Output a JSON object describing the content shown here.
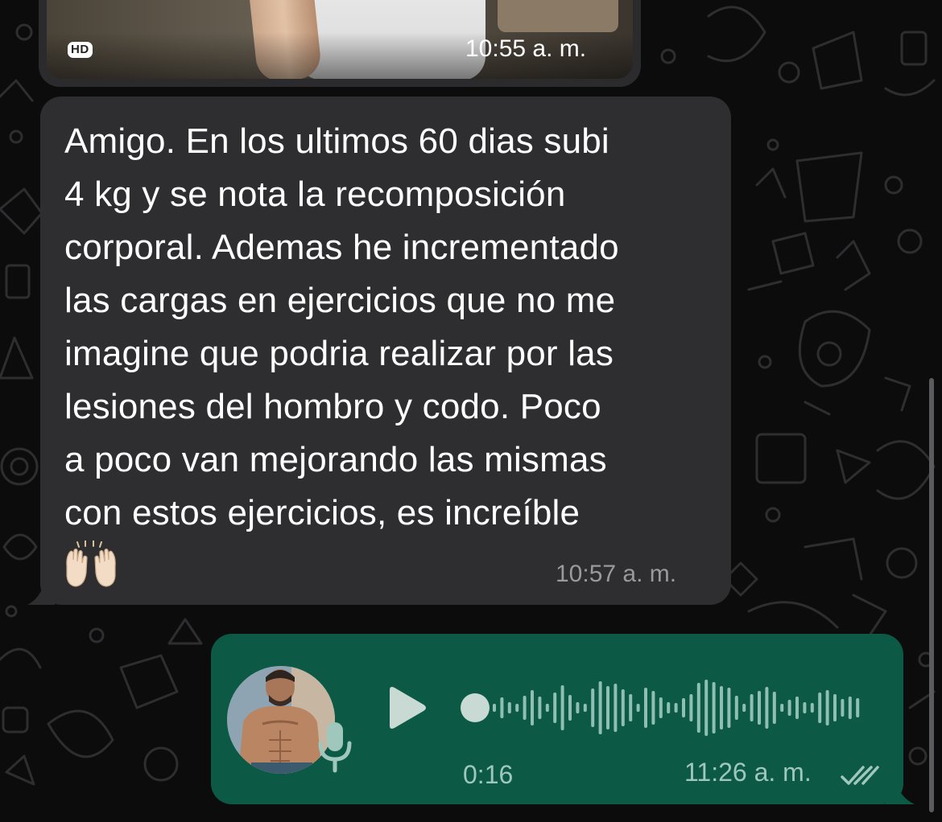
{
  "image_message": {
    "badge": "HD",
    "time": "10:55 a. m.",
    "icon": "hd-badge-icon"
  },
  "text_message": {
    "lines": [
      "Amigo. En los ultimos 60 dias subi",
      "4 kg y se nota la recomposición",
      "corporal. Ademas he incrementado",
      "las cargas en ejercicios que no me",
      "imagine que podria realizar por las",
      "lesiones del hombro y codo. Poco",
      "a poco van mejorando las mismas",
      "con estos ejercicios, es increíble"
    ],
    "emoji": "🙌🏻",
    "time": "10:57 a. m."
  },
  "voice_message": {
    "duration": "0:16",
    "time": "11:26 a. m.",
    "status_icon": "double-check-icon",
    "play_icon": "play-icon",
    "mic_icon": "microphone-icon",
    "playback_progress": 0
  },
  "colors": {
    "chat_background": "#0c0c0c",
    "incoming_bubble": "#2e2e30",
    "outgoing_bubble": "#0c5a46",
    "timestamp_incoming": "#9a9a9c",
    "timestamp_outgoing": "#9fc7bb",
    "waveform": "#8fbfb1"
  }
}
